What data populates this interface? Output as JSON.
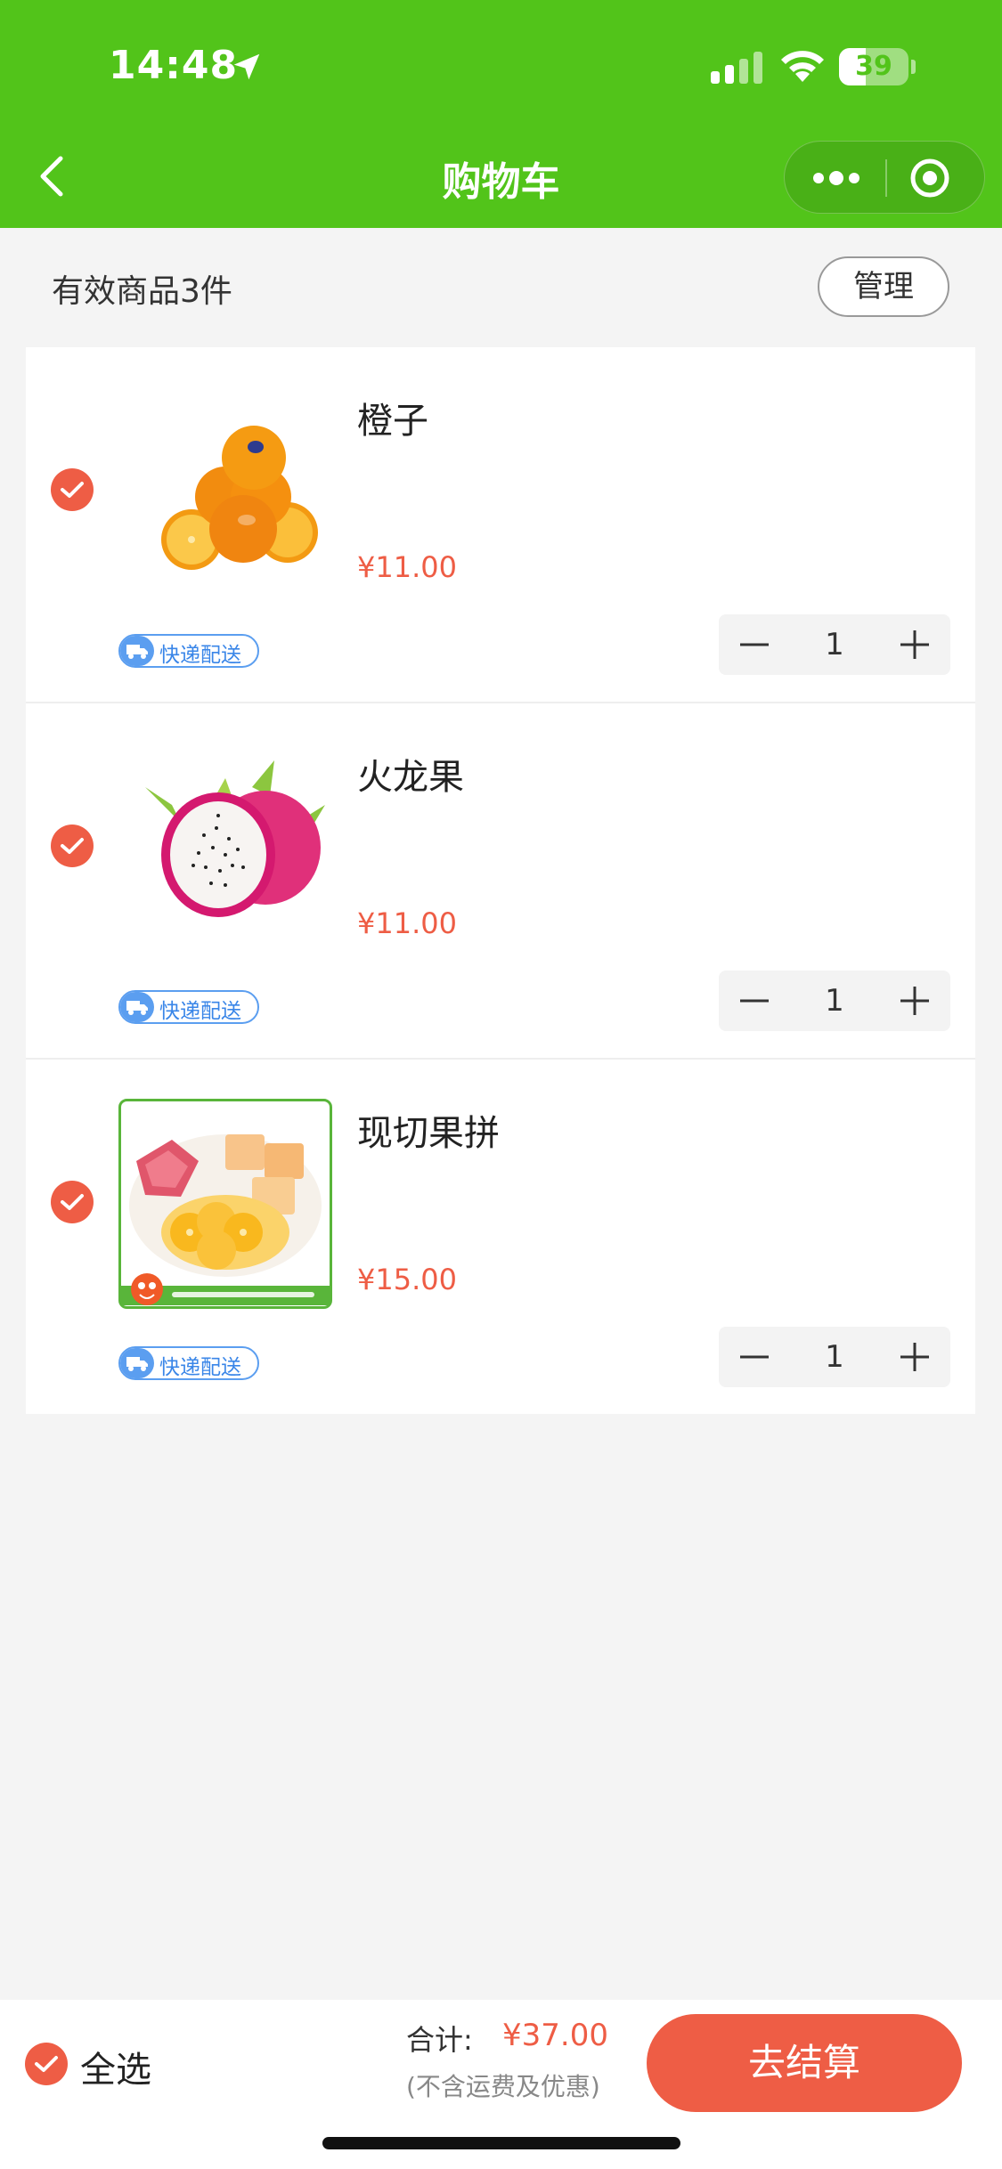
{
  "status_bar": {
    "time": "14:48",
    "battery_level": "39"
  },
  "nav": {
    "title": "购物车"
  },
  "summary": {
    "label": "有效商品3件",
    "manage_label": "管理"
  },
  "cart": {
    "items": [
      {
        "name": "橙子",
        "price": "¥11.00",
        "quantity": "1",
        "tag": "快递配送",
        "image": "oranges",
        "checked": true
      },
      {
        "name": "火龙果",
        "price": "¥11.00",
        "quantity": "1",
        "tag": "快递配送",
        "image": "dragon-fruit",
        "checked": true
      },
      {
        "name": "现切果拼",
        "price": "¥15.00",
        "quantity": "1",
        "tag": "快递配送",
        "image": "fruit-platter",
        "checked": true
      }
    ]
  },
  "bottom": {
    "select_all_label": "全选",
    "total_label": "合计:",
    "total_value": "¥37.00",
    "total_note": "(不含运费及优惠)",
    "checkout_label": "去结算"
  },
  "colors": {
    "brand_green": "#52c41a",
    "accent_red": "#ee5d45",
    "tag_blue": "#5b9ef0"
  }
}
